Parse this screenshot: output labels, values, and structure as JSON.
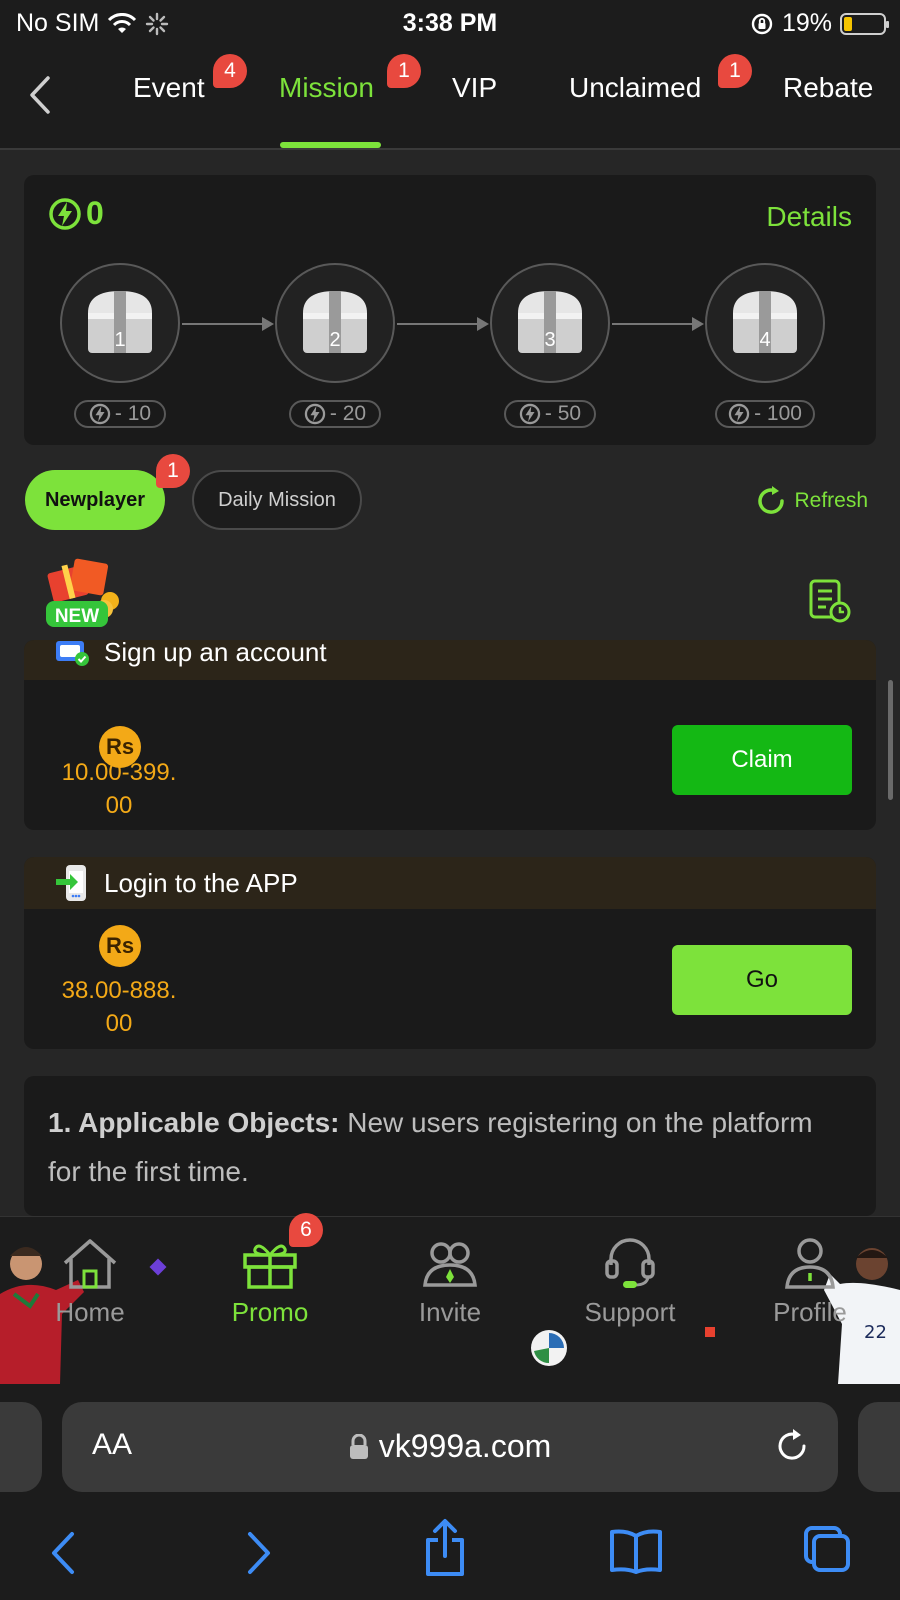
{
  "status_bar": {
    "carrier": "No SIM",
    "time": "3:38 PM",
    "battery_percent": "19%",
    "battery_level": 0.19
  },
  "tabs": [
    {
      "label": "Event",
      "badge": "4"
    },
    {
      "label": "Mission",
      "badge": "1",
      "active": true
    },
    {
      "label": "VIP"
    },
    {
      "label": "Unclaimed",
      "badge": "1"
    },
    {
      "label": "Rebate"
    }
  ],
  "progress": {
    "energy": "0",
    "details_label": "Details",
    "chests": [
      {
        "num": "1",
        "cost": "- 10"
      },
      {
        "num": "2",
        "cost": "- 20"
      },
      {
        "num": "3",
        "cost": "- 50"
      },
      {
        "num": "4",
        "cost": "- 100"
      }
    ]
  },
  "filters": {
    "newplayer_label": "Newplayer",
    "newplayer_badge": "1",
    "daily_label": "Daily Mission",
    "refresh_label": "Refresh"
  },
  "gift_new_label": "NEW",
  "missions": [
    {
      "title": "Sign up an account",
      "currency": "Rs",
      "amount_line1": "10.00-399.",
      "amount_line2": "00",
      "button": "Claim"
    },
    {
      "title": "Login to the APP",
      "currency": "Rs",
      "amount_line1": "38.00-888.",
      "amount_line2": "00",
      "button": "Go"
    }
  ],
  "rules": {
    "item1_heading": "1. Applicable Objects:",
    "item1_text": " New users registering on the platform for the first time."
  },
  "bottom_nav": [
    {
      "label": "Home"
    },
    {
      "label": "Promo",
      "badge": "6",
      "active": true
    },
    {
      "label": "Invite"
    },
    {
      "label": "Support"
    },
    {
      "label": "Profile"
    }
  ],
  "browser": {
    "text_size_label": "AA",
    "url": "vk999a.com"
  },
  "colors": {
    "accent_green": "#7de23b",
    "claim_green": "#14b814",
    "badge_red": "#e8493f",
    "coin_orange": "#f3a917",
    "browser_blue": "#3d8cf5"
  }
}
